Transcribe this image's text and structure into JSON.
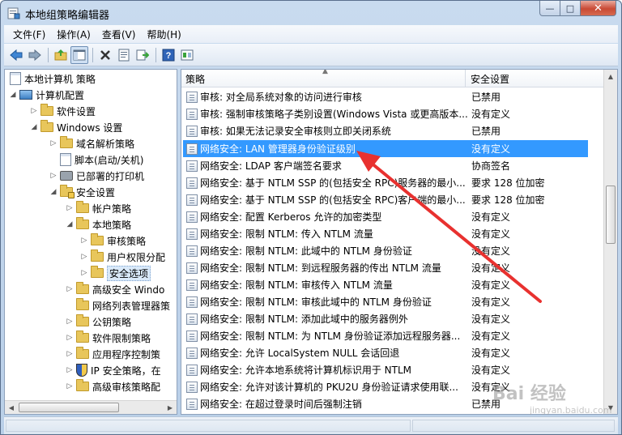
{
  "window": {
    "title": "本地组策略编辑器",
    "caption_min": "—",
    "caption_max": "□",
    "caption_close": "✕"
  },
  "menubar": {
    "items": [
      "文件(F)",
      "操作(A)",
      "查看(V)",
      "帮助(H)"
    ]
  },
  "toolbar": {
    "buttons": [
      "back-icon",
      "forward-icon",
      "up-folder-icon",
      "show-hide-tree-icon",
      "delete-icon",
      "properties-icon",
      "export-icon",
      "help-icon",
      "view-icon"
    ]
  },
  "tree": {
    "root": "本地计算机 策略",
    "items": [
      {
        "label": "计算机配置"
      },
      {
        "label": "软件设置"
      },
      {
        "label": "Windows 设置"
      },
      {
        "label": "域名解析策略"
      },
      {
        "label": "脚本(启动/关机)"
      },
      {
        "label": "已部署的打印机"
      },
      {
        "label": "安全设置"
      },
      {
        "label": "帐户策略"
      },
      {
        "label": "本地策略"
      },
      {
        "label": "审核策略"
      },
      {
        "label": "用户权限分配"
      },
      {
        "label": "安全选项"
      },
      {
        "label": "高级安全 Windo"
      },
      {
        "label": "网络列表管理器策"
      },
      {
        "label": "公钥策略"
      },
      {
        "label": "软件限制策略"
      },
      {
        "label": "应用程序控制策"
      },
      {
        "label": "IP 安全策略，在"
      },
      {
        "label": "高级审核策略配"
      }
    ]
  },
  "list": {
    "columns": {
      "policy": "策略",
      "setting": "安全设置"
    },
    "rows": [
      {
        "policy": "审核: 对全局系统对象的访问进行审核",
        "setting": "已禁用"
      },
      {
        "policy": "审核: 强制审核策略子类别设置(Windows Vista 或更高版本...",
        "setting": "没有定义"
      },
      {
        "policy": "审核: 如果无法记录安全审核则立即关闭系统",
        "setting": "已禁用"
      },
      {
        "policy": "网络安全: LAN 管理器身份验证级别",
        "setting": "没有定义"
      },
      {
        "policy": "网络安全: LDAP 客户端签名要求",
        "setting": "协商签名"
      },
      {
        "policy": "网络安全: 基于 NTLM SSP 的(包括安全 RPC)服务器的最小...",
        "setting": "要求 128 位加密"
      },
      {
        "policy": "网络安全: 基于 NTLM SSP 的(包括安全 RPC)客户端的最小...",
        "setting": "要求 128 位加密"
      },
      {
        "policy": "网络安全: 配置 Kerberos 允许的加密类型",
        "setting": "没有定义"
      },
      {
        "policy": "网络安全: 限制 NTLM: 传入 NTLM 流量",
        "setting": "没有定义"
      },
      {
        "policy": "网络安全: 限制 NTLM: 此域中的 NTLM 身份验证",
        "setting": "没有定义"
      },
      {
        "policy": "网络安全: 限制 NTLM: 到远程服务器的传出 NTLM 流量",
        "setting": "没有定义"
      },
      {
        "policy": "网络安全: 限制 NTLM: 审核传入 NTLM 流量",
        "setting": "没有定义"
      },
      {
        "policy": "网络安全: 限制 NTLM: 审核此域中的 NTLM 身份验证",
        "setting": "没有定义"
      },
      {
        "policy": "网络安全: 限制 NTLM: 添加此域中的服务器例外",
        "setting": "没有定义"
      },
      {
        "policy": "网络安全: 限制 NTLM: 为 NTLM 身份验证添加远程服务器...",
        "setting": "没有定义"
      },
      {
        "policy": "网络安全: 允许 LocalSystem NULL 会话回退",
        "setting": "没有定义"
      },
      {
        "policy": "网络安全: 允许本地系统将计算机标识用于 NTLM",
        "setting": "没有定义"
      },
      {
        "policy": "网络安全: 允许对该计算机的 PKU2U 身份验证请求使用联...",
        "setting": "没有定义"
      },
      {
        "policy": "网络安全: 在超过登录时间后强制注销",
        "setting": "已禁用"
      }
    ]
  },
  "watermark": {
    "main": "Bai 经验",
    "sub": "jingyan.baidu.com"
  },
  "colors": {
    "selection": "#3399ff",
    "annotation_arrow": "#e8312f"
  }
}
